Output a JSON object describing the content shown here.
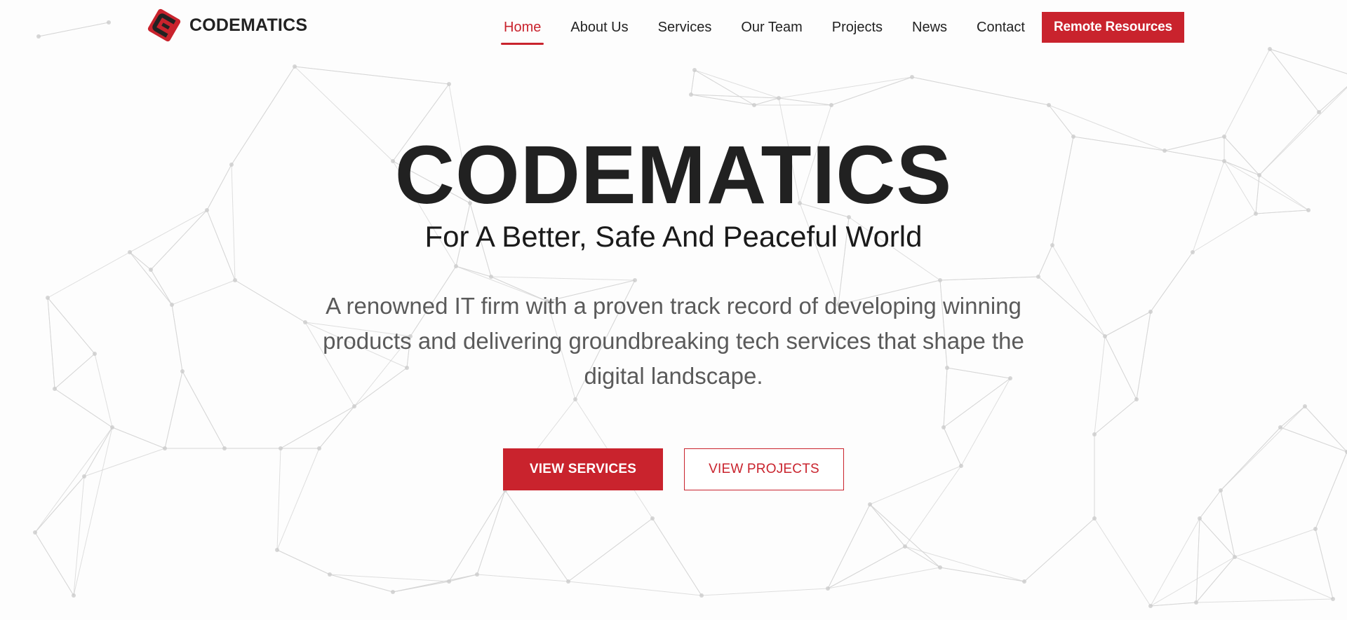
{
  "brand": {
    "name": "CODEMATICS",
    "logo_icon": "codematics-logo-icon",
    "accent_color": "#c9232d",
    "logo_dark_color": "#222222"
  },
  "nav": {
    "items": [
      {
        "label": "Home",
        "active": true
      },
      {
        "label": "About Us",
        "active": false
      },
      {
        "label": "Services",
        "active": false
      },
      {
        "label": "Our Team",
        "active": false
      },
      {
        "label": "Projects",
        "active": false
      },
      {
        "label": "News",
        "active": false
      },
      {
        "label": "Contact",
        "active": false
      }
    ],
    "cta_label": "Remote Resources"
  },
  "hero": {
    "title": "CODEMATICS",
    "subtitle": "For A Better, Safe And Peaceful World",
    "description": "A renowned IT firm with a proven track record of developing winning products and delivering groundbreaking tech services that shape the digital landscape.",
    "primary_button": "VIEW SERVICES",
    "secondary_button": "VIEW PROJECTS"
  },
  "colors": {
    "title": "#212121",
    "body_text": "#5a5a5a",
    "background": "#fdfdfd",
    "network_lines": "#d4d4d4"
  }
}
